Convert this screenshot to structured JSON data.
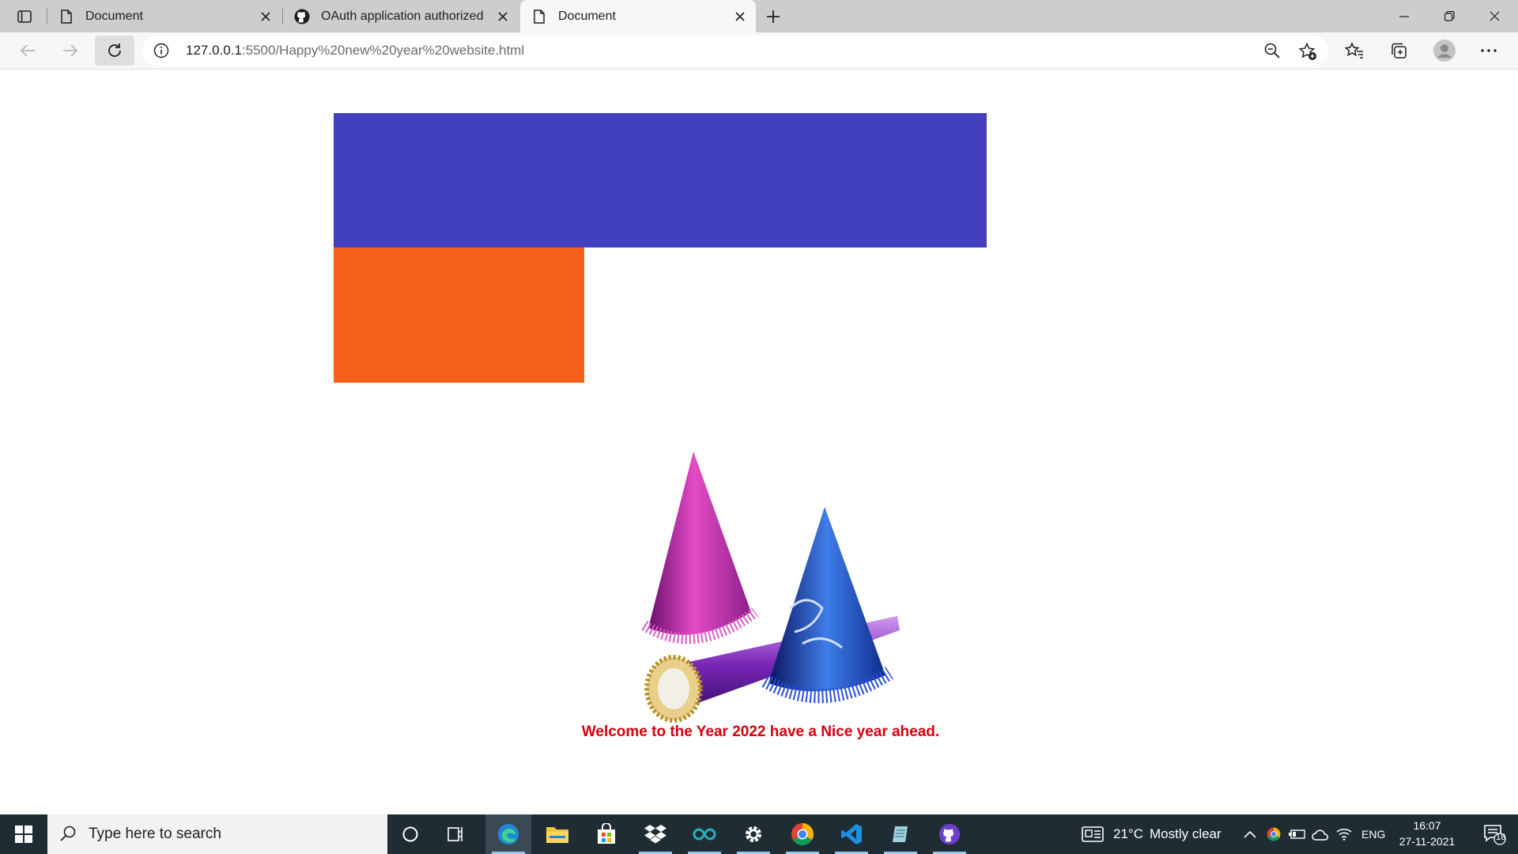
{
  "browser": {
    "tabs": [
      {
        "title": "Document",
        "icon": "page-icon",
        "active": false
      },
      {
        "title": "OAuth application authorized",
        "icon": "github-icon",
        "active": false
      },
      {
        "title": "Document",
        "icon": "page-icon",
        "active": true
      }
    ],
    "address": {
      "host": "127.0.0.1",
      "path": ":5500/Happy%20new%20year%20website.html"
    }
  },
  "page": {
    "colors": {
      "blue_box": "#4240bf",
      "orange_box": "#f55f19",
      "message": "#d4000e"
    },
    "image_description_icon": "party-hats-icon",
    "message": "Welcome to the Year 2022 have a Nice year ahead."
  },
  "taskbar": {
    "search_placeholder": "Type here to search",
    "weather": {
      "temp": "21°C",
      "condition": "Mostly clear"
    },
    "language": "ENG",
    "time": "16:07",
    "date": "27-11-2021",
    "notification_count": "18"
  }
}
